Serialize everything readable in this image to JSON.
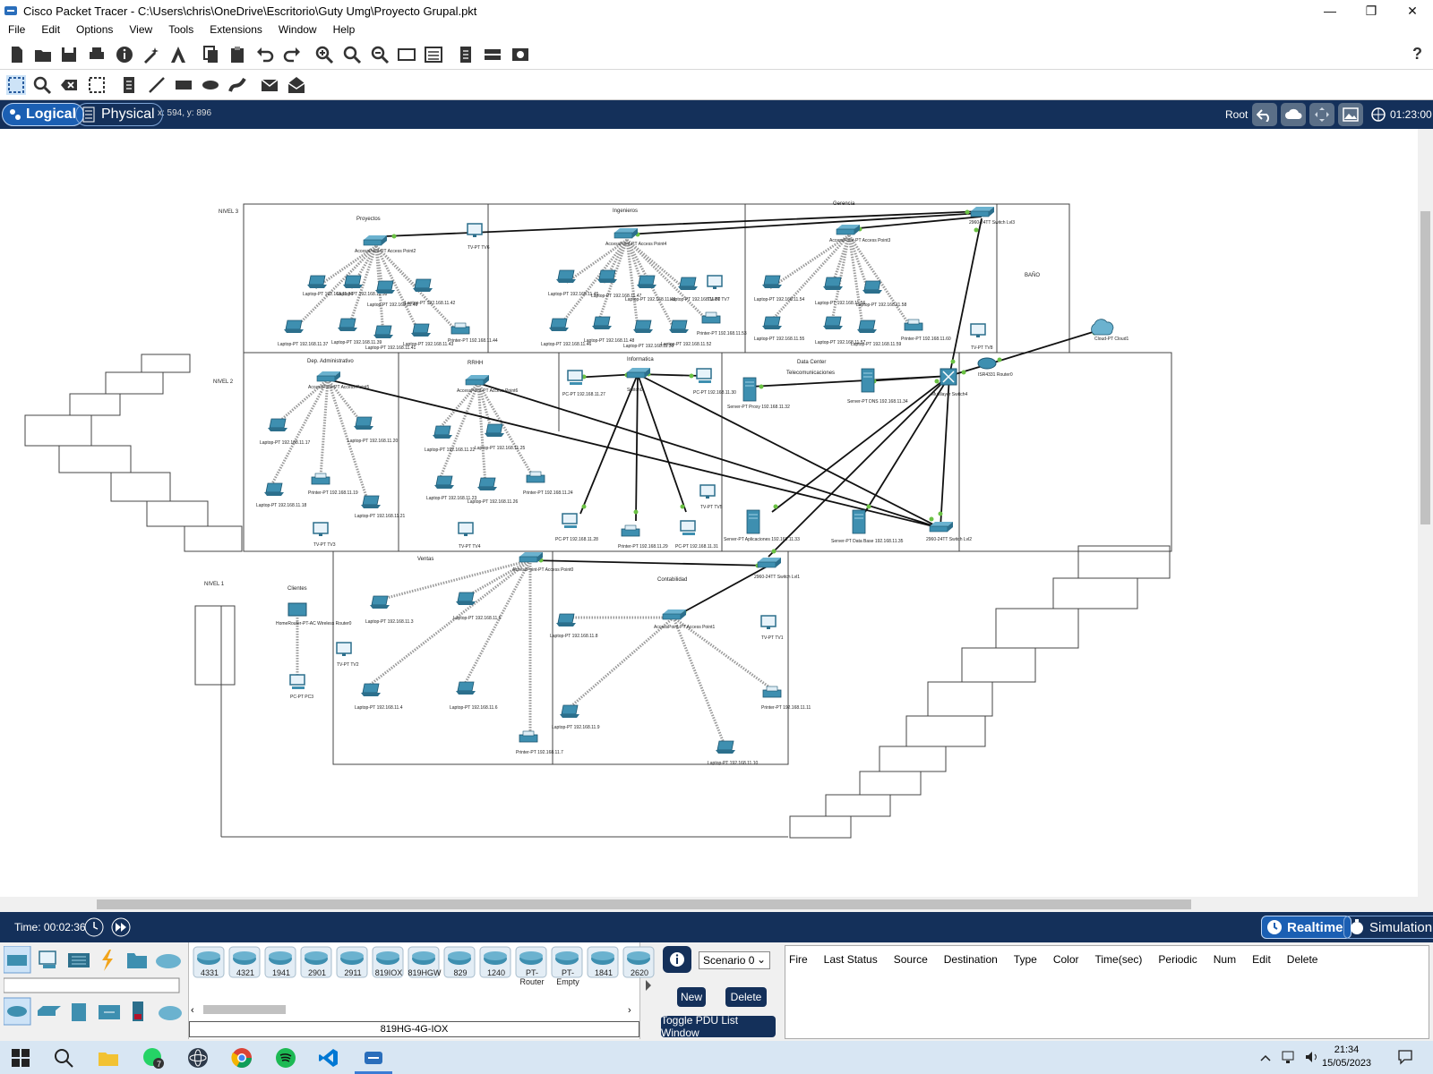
{
  "window": {
    "title": "Cisco Packet Tracer - C:\\Users\\chris\\OneDrive\\Escritorio\\Guty Umg\\Proyecto Grupal.pkt"
  },
  "menu": [
    "File",
    "Edit",
    "Options",
    "View",
    "Tools",
    "Extensions",
    "Window",
    "Help"
  ],
  "toolbar": {
    "help": "?"
  },
  "modes": {
    "logical": "Logical",
    "physical": "Physical",
    "coords": "x: 594, y: 896",
    "root": "Root",
    "clock": "01:23:00"
  },
  "floors": {
    "nivel3": "NIVEL 3",
    "nivel2": "NIVEL 2",
    "nivel1": "NIVEL 1",
    "bano": "BAÑO"
  },
  "areas": {
    "proyectos": "Proyectos",
    "ingenieros": "Ingenieros",
    "gerencia": "Gerencia",
    "dep_admin": "Dep. Administrativo",
    "rrhh": "RRHH",
    "informatica": "Informatica",
    "data_center": "Data Center",
    "telecom": "Telecomunicaciones",
    "ventas": "Ventas",
    "contabilidad": "Contabilidad",
    "clientes": "Clientes"
  },
  "devices": {
    "sw_lvl3": "2960-24TT Switch Lvl3",
    "ap_proy": "AccessPoint-PT Access Point2",
    "ap_ing": "AccessPoint-PT Access Point4",
    "ap_ger": "AccessPoint-PT Access Point3",
    "ap_admin": "AccessPoint-PT Access Point5",
    "ap_rrhh": "AccessPoint-PT Access Point6",
    "sw_info": "Switch0",
    "mls": "Multilayer Switch4",
    "router": "ISR4331 Router0",
    "cloud": "Cloud-PT Cloud1",
    "server_proxy": "Server-PT Proxy 192.168.11.32",
    "server_dns": "Server-PT DNS 192.168.11.34",
    "server_app": "Server-PT Aplicaciones 192.168.11.33",
    "server_db": "Server-PT Data Base 192.168.11.35",
    "sw_lvl2": "2960-24TT Switch Lvl2",
    "ap_ventas": "AccessPoint-PT Access Point0",
    "ap_cont": "AccessPoint-PT Access Point1",
    "sw_lvl1": "2960-24TT Switch Lvl1",
    "home_router": "HomeRouter-PT-AC Wireless Router0",
    "pc3": "PC-PT PC3"
  },
  "hosts": {
    "proy": [
      "Laptop-PT 192.168.11.36",
      "Laptop-PT 192.168.11.38",
      "Laptop-PT 192.168.11.40",
      "Laptop-PT 192.168.11.42",
      "Laptop-PT 192.168.11.37",
      "Laptop-PT 192.168.11.39",
      "Laptop-PT 192.168.11.41",
      "Laptop-PT 192.168.11.43",
      "Printer-PT 192.168.11.44"
    ],
    "ing": [
      "Laptop-PT 192.168.11.45",
      "Laptop-PT 192.168.11.47",
      "Laptop-PT 192.168.11.49",
      "Laptop-PT 192.168.11.50",
      "Laptop-PT 192.168.11.46",
      "Laptop-PT 192.168.11.48",
      "Laptop-PT 192.168.11.30",
      "Laptop-PT 192.168.11.52",
      "Printer-PT 192.168.11.53"
    ],
    "ger": [
      "Laptop-PT 192.168.11.54",
      "Laptop-PT 192.168.11.56",
      "Laptop-PT 192.168.11.58",
      "Laptop-PT 192.168.11.55",
      "Laptop-PT 192.168.11.57",
      "Laptop-PT 192.168.11.59",
      "Printer-PT 192.168.11.60"
    ],
    "admin": [
      "Laptop-PT 192.168.11.17",
      "Laptop-PT 192.168.11.20",
      "Laptop-PT 192.168.11.18",
      "Printer-PT 192.168.11.19",
      "Laptop-PT 192.168.11.21"
    ],
    "rrhh": [
      "Laptop-PT 192.168.11.22",
      "Laptop-PT 192.168.11.25",
      "Laptop-PT 192.168.11.23",
      "Laptop-PT 192.168.11.26",
      "Printer-PT 192.168.11.24"
    ],
    "info": [
      "PC-PT 192.168.11.27",
      "PC-PT 192.168.11.30",
      "PC-PT 192.168.11.28",
      "Printer-PT 192.168.11.29",
      "PC-PT 192.168.11.31"
    ],
    "ventas": [
      "Laptop-PT 192.168.11.3",
      "Laptop-PT 192.168.11.5",
      "Laptop-PT 192.168.11.4",
      "Laptop-PT 192.168.11.6",
      "Printer-PT 192.168.11.7"
    ],
    "cont": [
      "Laptop-PT 192.168.11.8",
      "Laptop-PT 192.168.11.9",
      "Laptop-PT 192.168.11.10",
      "Printer-PT 192.168.11.11"
    ],
    "tvs": [
      "TV-PT TV6",
      "TV-PT TV7",
      "TV-PT TV8",
      "TV-PT TV3",
      "TV-PT TV4",
      "TV-PT TV5",
      "TV-PT TV2",
      "TV-PT TV1"
    ]
  },
  "status": {
    "time": "Time: 00:02:36",
    "realtime": "Realtime",
    "simulation": "Simulation"
  },
  "device_models": [
    "4331",
    "4321",
    "1941",
    "2901",
    "2911",
    "819IOX",
    "819HGW",
    "829",
    "1240",
    "PT-Router",
    "PT-Empty",
    "1841",
    "2620"
  ],
  "selected_model": "819HG-4G-IOX",
  "scenario": {
    "select": "Scenario 0",
    "new": "New",
    "delete": "Delete",
    "toggle": "Toggle PDU List Window"
  },
  "pdu_columns": [
    "Fire",
    "Last Status",
    "Source",
    "Destination",
    "Type",
    "Color",
    "Time(sec)",
    "Periodic",
    "Num",
    "Edit",
    "Delete"
  ],
  "taskbar": {
    "time": "21:34",
    "date": "15/05/2023",
    "whatsapp_badge": "7"
  }
}
